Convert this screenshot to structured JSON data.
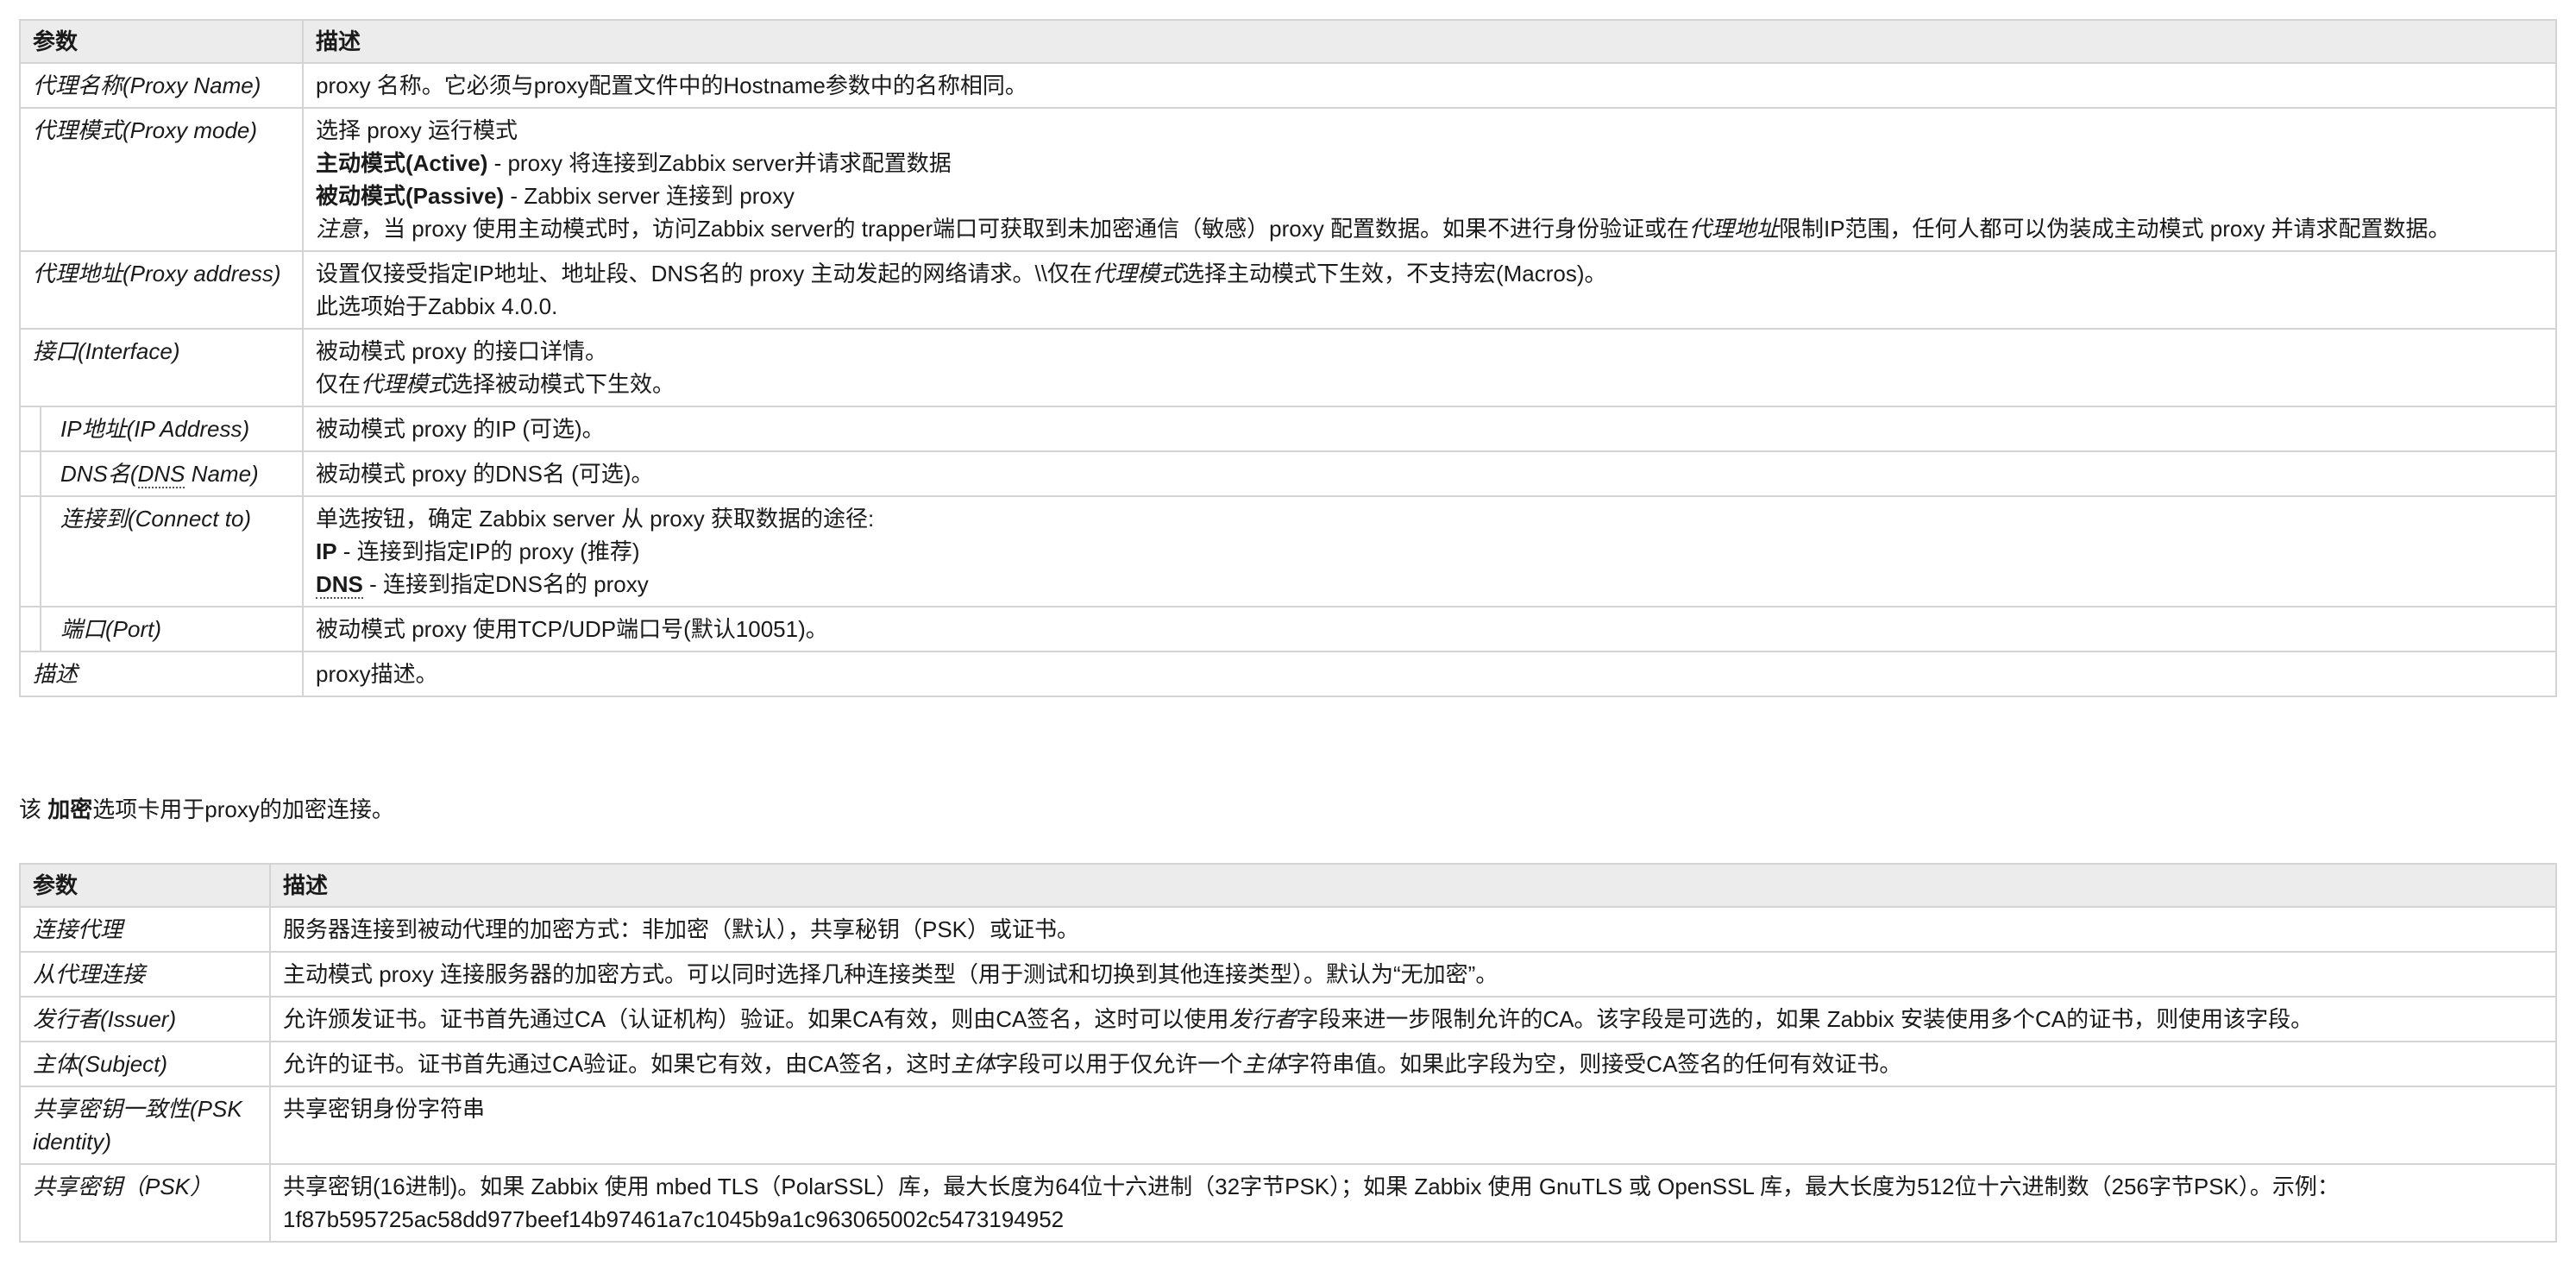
{
  "table1": {
    "headers": [
      "参数",
      "描述"
    ],
    "rows": [
      {
        "param": "代理名称(Proxy Name)",
        "lines": [
          "proxy 名称。它必须与proxy配置文件中的Hostname参数中的名称相同。"
        ]
      },
      {
        "param": "代理模式(Proxy mode)",
        "lines": [
          "选择 proxy 运行模式",
          "主动模式(Active)",
          " - proxy 将连接到Zabbix server并请求配置数据",
          "被动模式(Passive)",
          " - Zabbix server 连接到 proxy",
          "注意",
          "，当 proxy 使用主动模式时，访问Zabbix server的 trapper端口可获取到未加密通信（敏感）proxy 配置数据。如果不进行身份验证或在",
          "代理地址",
          "限制IP范围，任何人都可以伪装成主动模式 proxy 并请求配置数据。"
        ]
      },
      {
        "param": "代理地址(Proxy address)",
        "lines": [
          "设置仅接受指定IP地址、地址段、DNS名的 proxy 主动发起的网络请求。\\\\仅在",
          "代理模式",
          "选择主动模式下生效，不支持宏(Macros)。",
          "此选项始于Zabbix 4.0.0."
        ]
      },
      {
        "param": "接口(Interface)",
        "lines": [
          "被动模式 proxy 的接口详情。",
          "仅在",
          "代理模式",
          "选择被动模式下生效。"
        ]
      },
      {
        "param": "IP地址(IP Address)",
        "lines": [
          "被动模式 proxy 的IP (可选)。"
        ]
      },
      {
        "param_a": "DNS名(",
        "param_b": "DNS",
        "param_c": " Name)",
        "lines": [
          "被动模式 proxy 的DNS名 (可选)。"
        ]
      },
      {
        "param": "连接到(Connect to)",
        "lines": [
          "单选按钮，确定 Zabbix server 从 proxy 获取数据的途径:",
          "IP",
          " - 连接到指定IP的 proxy (推荐)",
          "DNS",
          " - 连接到指定DNS名的 proxy"
        ]
      },
      {
        "param": "端口(Port)",
        "lines": [
          "被动模式 proxy 使用TCP/UDP端口号(默认10051)。"
        ]
      },
      {
        "param": "描述",
        "lines": [
          "proxy描述。"
        ]
      }
    ]
  },
  "intro": {
    "pre": "该 ",
    "bold": "加密",
    "post": "选项卡用于proxy的加密连接。"
  },
  "table2": {
    "headers": [
      "参数",
      "描述"
    ],
    "rows": [
      {
        "param": "连接代理",
        "lines": [
          "服务器连接到被动代理的加密方式：非加密（默认），共享秘钥（PSK）或证书。"
        ]
      },
      {
        "param": "从代理连接",
        "lines": [
          "主动模式 proxy 连接服务器的加密方式。可以同时选择几种连接类型（用于测试和切换到其他连接类型）。默认为“无加密”。"
        ]
      },
      {
        "param": "发行者(Issuer)",
        "lines": [
          "允许颁发证书。证书首先通过CA（认证机构）验证。如果CA有效，则由CA签名，这时可以使用",
          "发行者",
          "字段来进一步限制允许的CA。该字段是可选的，如果 Zabbix 安装使用多个CA的证书，则使用该字段。"
        ]
      },
      {
        "param": "主体(Subject)",
        "lines": [
          "允许的证书。证书首先通过CA验证。如果它有效，由CA签名，这时",
          "主体",
          "字段可以用于仅允许一个",
          "主体",
          "字符串值。如果此字段为空，则接受CA签名的任何有效证书。"
        ]
      },
      {
        "param": "共享密钥一致性(PSK identity)",
        "lines": [
          "共享密钥身份字符串"
        ]
      },
      {
        "param": "共享密钥（PSK）",
        "lines": [
          "共享密钥(16进制)。如果 Zabbix 使用 mbed TLS（PolarSSL）库，最大长度为64位十六进制（32字节PSK）；如果 Zabbix 使用 GnuTLS 或 OpenSSL 库，最大长度为512位十六进制数（256字节PSK）。示例：",
          "1f87b595725ac58dd977beef14b97461a7c1045b9a1c963065002c5473194952"
        ]
      }
    ]
  }
}
